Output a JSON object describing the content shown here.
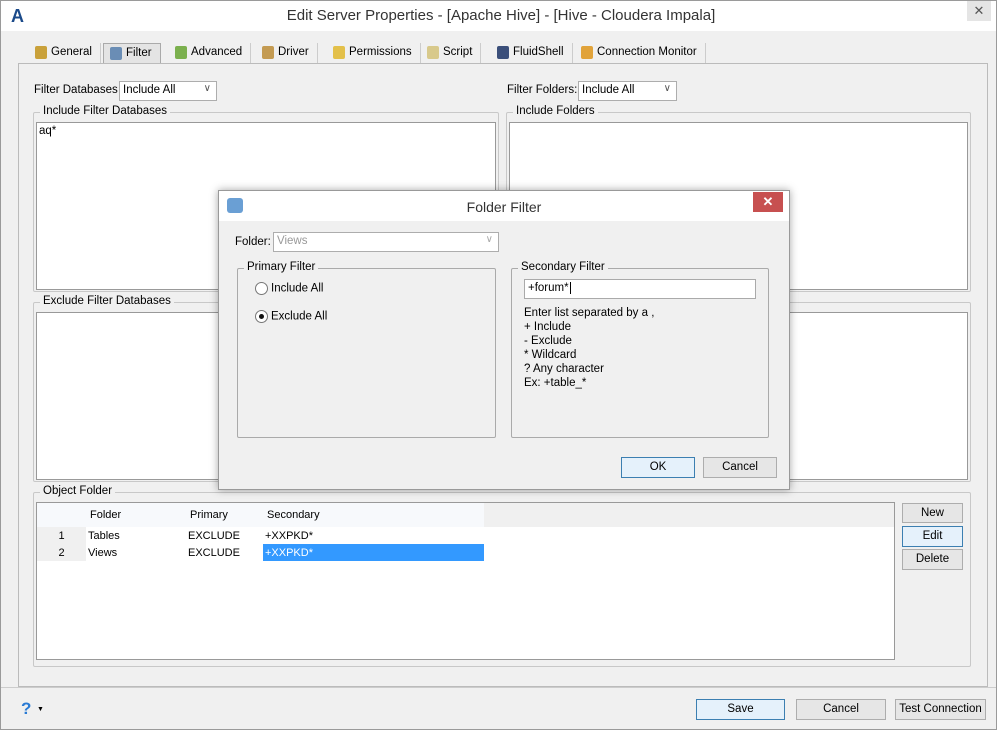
{
  "window": {
    "title": "Edit Server Properties - [Apache Hive] - [Hive - Cloudera Impala]",
    "close": "✕",
    "logo": "A"
  },
  "tabs": [
    {
      "label": "General"
    },
    {
      "label": "Filter",
      "active": true
    },
    {
      "label": "Advanced"
    },
    {
      "label": "Driver"
    },
    {
      "label": "Permissions"
    },
    {
      "label": "Script"
    },
    {
      "label": "FluidShell"
    },
    {
      "label": "Connection Monitor"
    }
  ],
  "filter": {
    "filter_databases_label": "Filter Databases",
    "filter_databases_value": "Include All",
    "filter_folders_label": "Filter Folders:",
    "filter_folders_value": "Include All",
    "include_db_label": "Include Filter Databases",
    "include_db_value": "aq*",
    "include_folders_label": "Include Folders",
    "exclude_db_label": "Exclude Filter Databases",
    "object_folder_label": "Object Folder",
    "table": {
      "columns": [
        "",
        "Folder",
        "Primary",
        "Secondary"
      ],
      "rows": [
        [
          "1",
          "Tables",
          "EXCLUDE",
          "+XXPKD*"
        ],
        [
          "2",
          "Views",
          "EXCLUDE",
          "+XXPKD*"
        ]
      ],
      "selected_row": 2
    },
    "buttons": {
      "new": "New",
      "edit": "Edit",
      "delete": "Delete"
    }
  },
  "footer": {
    "help": "?",
    "save": "Save",
    "cancel": "Cancel",
    "test": "Test Connection"
  },
  "dialog": {
    "title": "Folder Filter",
    "close": "✕",
    "folder_label": "Folder:",
    "folder_value": "Views",
    "primary_label": "Primary Filter",
    "include_all": "Include All",
    "exclude_all": "Exclude All",
    "selected": "Exclude All",
    "secondary_label": "Secondary Filter",
    "secondary_value": "+forum*",
    "help": [
      "Enter list separated by a ,",
      "+ Include",
      "- Exclude",
      "* Wildcard",
      "? Any character",
      "Ex: +table_*"
    ],
    "ok": "OK",
    "cancel": "Cancel"
  },
  "colors": {
    "selection": "#3399ff",
    "dialog_close": "#c75050"
  }
}
